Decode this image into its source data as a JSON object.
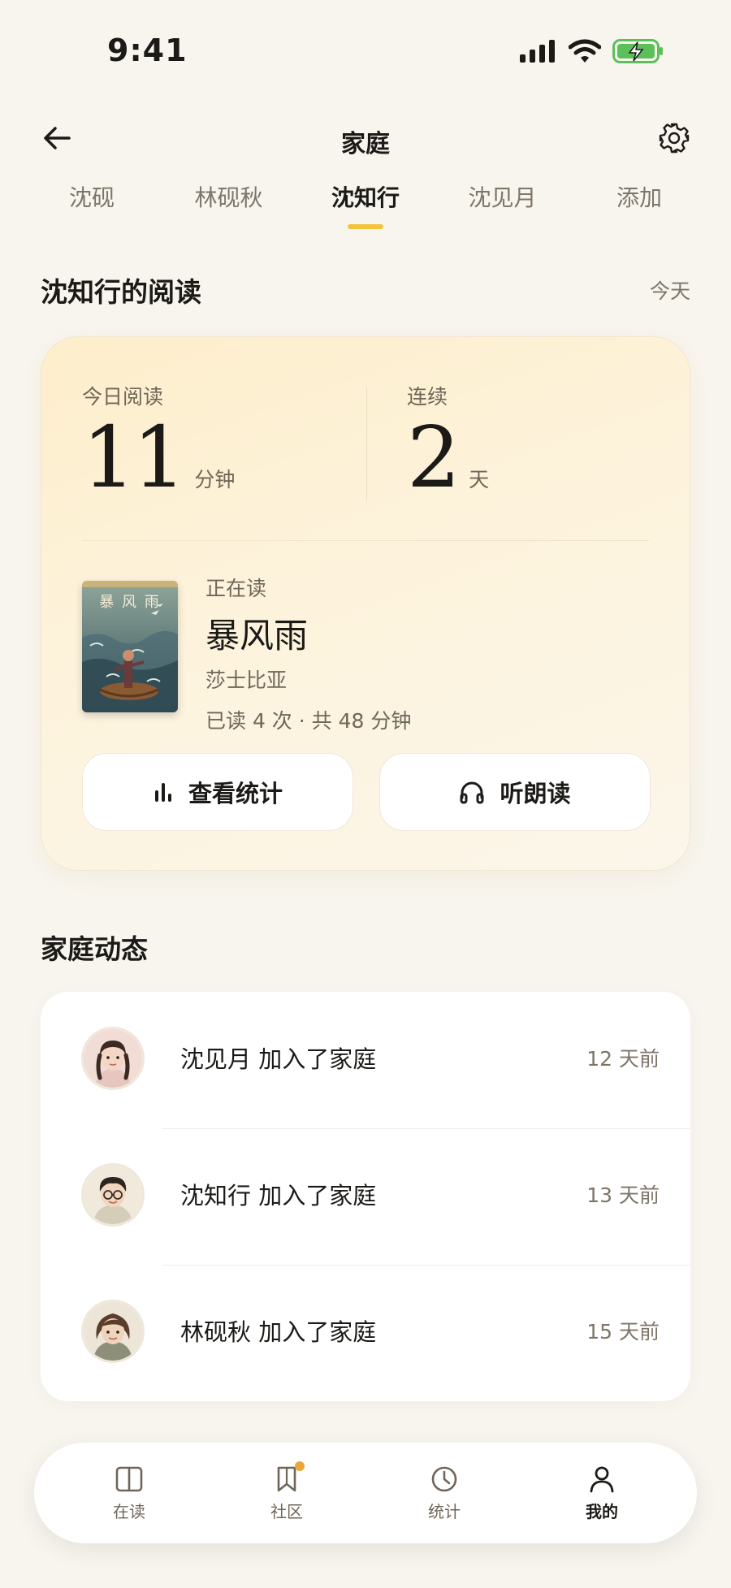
{
  "status_bar": {
    "time": "9:41"
  },
  "header": {
    "title": "家庭"
  },
  "tabs": [
    {
      "label": "沈砚",
      "active": false
    },
    {
      "label": "林砚秋",
      "active": false
    },
    {
      "label": "沈知行",
      "active": true
    },
    {
      "label": "沈见月",
      "active": false
    },
    {
      "label": "添加",
      "active": false
    }
  ],
  "reading_section": {
    "title": "沈知行的阅读",
    "range": "今天"
  },
  "reading_card": {
    "today": {
      "label": "今日阅读",
      "value": "11",
      "unit": "分钟"
    },
    "streak": {
      "label": "连续",
      "value": "2",
      "unit": "天"
    },
    "book": {
      "status": "正在读",
      "title": "暴风雨",
      "author": "莎士比亚",
      "meta": "已读 4 次 · 共 48 分钟",
      "cover_text": "暴 风 雨"
    },
    "stats_button": "查看统计",
    "listen_button": "听朗读",
    "accent_color": "#f2c43c"
  },
  "family_section": {
    "title": "家庭动态"
  },
  "feed": [
    {
      "text": "沈见月 加入了家庭",
      "time": "12 天前"
    },
    {
      "text": "沈知行 加入了家庭",
      "time": "13 天前"
    },
    {
      "text": "林砚秋 加入了家庭",
      "time": "15 天前"
    }
  ],
  "bottom_nav": [
    {
      "label": "在读",
      "icon": "book-open-icon",
      "active": false
    },
    {
      "label": "社区",
      "icon": "bookmark-icon",
      "active": false,
      "badge": true
    },
    {
      "label": "统计",
      "icon": "clock-icon",
      "active": false
    },
    {
      "label": "我的",
      "icon": "person-icon",
      "active": true
    }
  ]
}
